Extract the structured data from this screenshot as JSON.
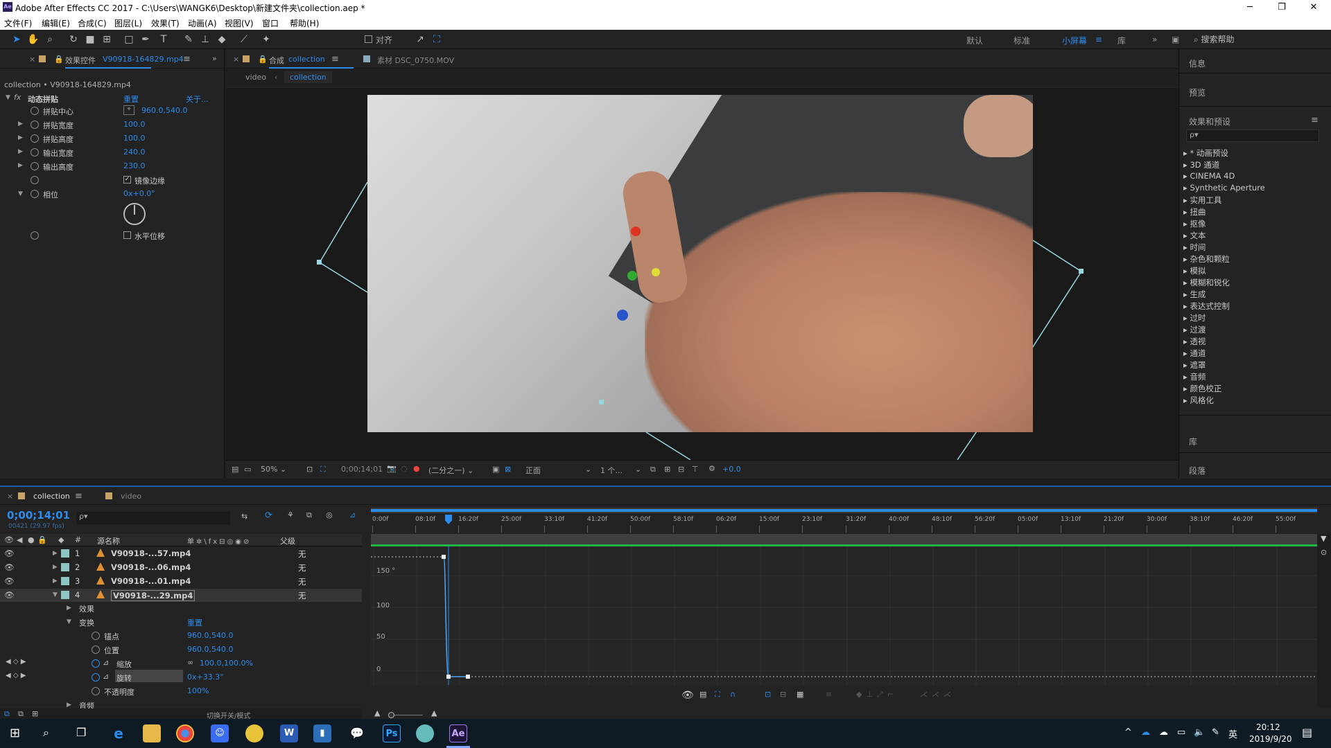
{
  "window": {
    "title": "Adobe After Effects CC 2017 - C:\\Users\\WANGK6\\Desktop\\新建文件夹\\collection.aep *",
    "minimize": "─",
    "maximize": "❐",
    "close": "✕"
  },
  "menu": [
    "文件(F)",
    "编辑(E)",
    "合成(C)",
    "图层(L)",
    "效果(T)",
    "动画(A)",
    "视图(V)",
    "窗口",
    "帮助(H)"
  ],
  "toolbar": {
    "align_label": "对齐",
    "workspaces": [
      "默认",
      "标准",
      "小屏幕",
      "库"
    ],
    "active_workspace": "小屏幕",
    "search_placeholder": "搜索帮助"
  },
  "effects_panel": {
    "tab_label": "效果控件",
    "tab_file": "V90918-164829.mp4",
    "breadcrumb": "collection • V90918-164829.mp4",
    "effect_name": "动态拼贴",
    "reset": "重置",
    "about": "关于...",
    "props": [
      {
        "label": "拼贴中心",
        "value": "960.0,540.0"
      },
      {
        "label": "拼贴宽度",
        "value": "100.0"
      },
      {
        "label": "拼贴高度",
        "value": "100.0"
      },
      {
        "label": "输出宽度",
        "value": "240.0"
      },
      {
        "label": "输出高度",
        "value": "230.0"
      },
      {
        "label": "镜像边缘",
        "value": ""
      },
      {
        "label": "相位",
        "value": "0x+0.0°"
      },
      {
        "label": "水平位移",
        "value": ""
      }
    ]
  },
  "comp_panel": {
    "tab_comp_prefix": "合成",
    "tab_comp": "collection",
    "tab_footage": "素材 DSC_0750.MOV",
    "crumbs": [
      "video",
      "collection"
    ],
    "zoom": "50%",
    "timecode": "0;00;14;01",
    "resolution": "(二分之一)",
    "view": "正面",
    "views_count": "1 个...",
    "exposure": "+0.0"
  },
  "right_panel": {
    "info": "信息",
    "preview": "预览",
    "effects_presets": "效果和预设",
    "search_placeholder": "ρ▾",
    "categories": [
      "* 动画预设",
      "3D 通道",
      "CINEMA 4D",
      "Synthetic Aperture",
      "实用工具",
      "扭曲",
      "抠像",
      "文本",
      "时间",
      "杂色和颗粒",
      "模拟",
      "模糊和锐化",
      "生成",
      "表达式控制",
      "过时",
      "过渡",
      "透视",
      "通道",
      "遮罩",
      "音频",
      "颜色校正",
      "风格化"
    ],
    "library": "库",
    "paragraph": "段落"
  },
  "timeline": {
    "tab_comp": "collection",
    "tab_video": "video",
    "timecode": "0;00;14;01",
    "frames_info": "00421 (29.97 fps)",
    "search_placeholder": "ρ▾",
    "col_source": "源名称",
    "col_parent": "父级",
    "ruler": [
      "0:00f",
      "08:10f",
      "16:20f",
      "25:00f",
      "33:10f",
      "41:20f",
      "50:00f",
      "58:10f",
      "06:20f",
      "15:00f",
      "23:10f",
      "31:20f",
      "40:00f",
      "48:10f",
      "56:20f",
      "05:00f",
      "13:10f",
      "21:20f",
      "30:00f",
      "38:10f",
      "46:20f",
      "55:00f"
    ],
    "playhead_fraction": 0.082,
    "layers": [
      {
        "num": "1",
        "name": "V90918-...57.mp4",
        "parent": "无"
      },
      {
        "num": "2",
        "name": "V90918-...06.mp4",
        "parent": "无"
      },
      {
        "num": "3",
        "name": "V90918-...01.mp4",
        "parent": "无"
      },
      {
        "num": "4",
        "name": "V90918-...29.mp4",
        "parent": "无"
      }
    ],
    "props": {
      "effects": "效果",
      "transform": "变换",
      "reset": "重置",
      "anchor": "锚点",
      "anchor_val": "960.0,540.0",
      "position": "位置",
      "position_val": "960.0,540.0",
      "scale": "缩放",
      "scale_val": "100.0,100.0%",
      "rotation": "旋转",
      "rotation_val": "0x+33.3°",
      "opacity": "不透明度",
      "opacity_val": "100%",
      "audio": "音频"
    },
    "graph_y_labels": [
      "150 °",
      "100",
      "50",
      "0"
    ],
    "footer_toggle": "切换开关/模式"
  },
  "taskbar": {
    "time": "20:12",
    "date": "2019/9/20",
    "ime": "英"
  }
}
